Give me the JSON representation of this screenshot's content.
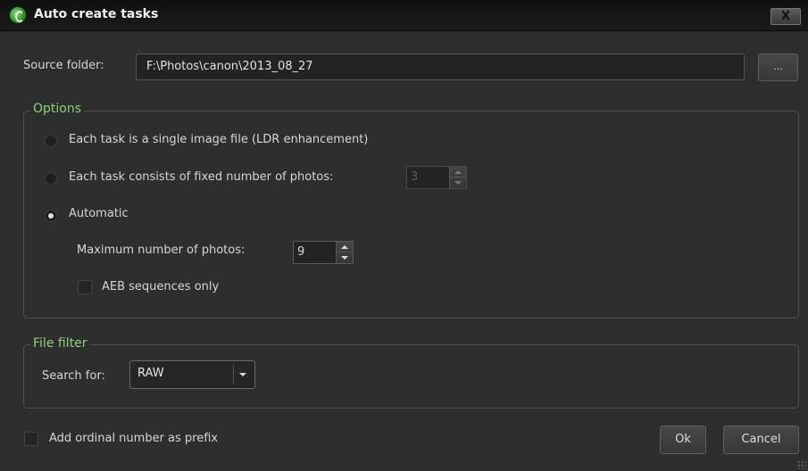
{
  "window": {
    "title": "Auto create tasks",
    "close_label": "X"
  },
  "source": {
    "label": "Source folder:",
    "value": "F:\\Photos\\canon\\2013_08_27",
    "browse_label": "..."
  },
  "options": {
    "group_title": "Options",
    "radio_single_label": "Each task is a single image file (LDR enhancement)",
    "radio_fixed_label": "Each task consists of fixed number of photos:",
    "fixed_count": "3",
    "radio_auto_label": "Automatic",
    "max_label": "Maximum number of photos:",
    "max_count": "9",
    "aeb_label": "AEB sequences only",
    "selected": "Automatic"
  },
  "file_filter": {
    "group_title": "File filter",
    "search_label": "Search for:",
    "search_value": "RAW"
  },
  "footer": {
    "prefix_label": "Add ordinal number as prefix",
    "ok_label": "Ok",
    "cancel_label": "Cancel"
  },
  "colors": {
    "background": "#2e2e2e",
    "accent": "#8fd07b",
    "titlebar": "#141414"
  }
}
